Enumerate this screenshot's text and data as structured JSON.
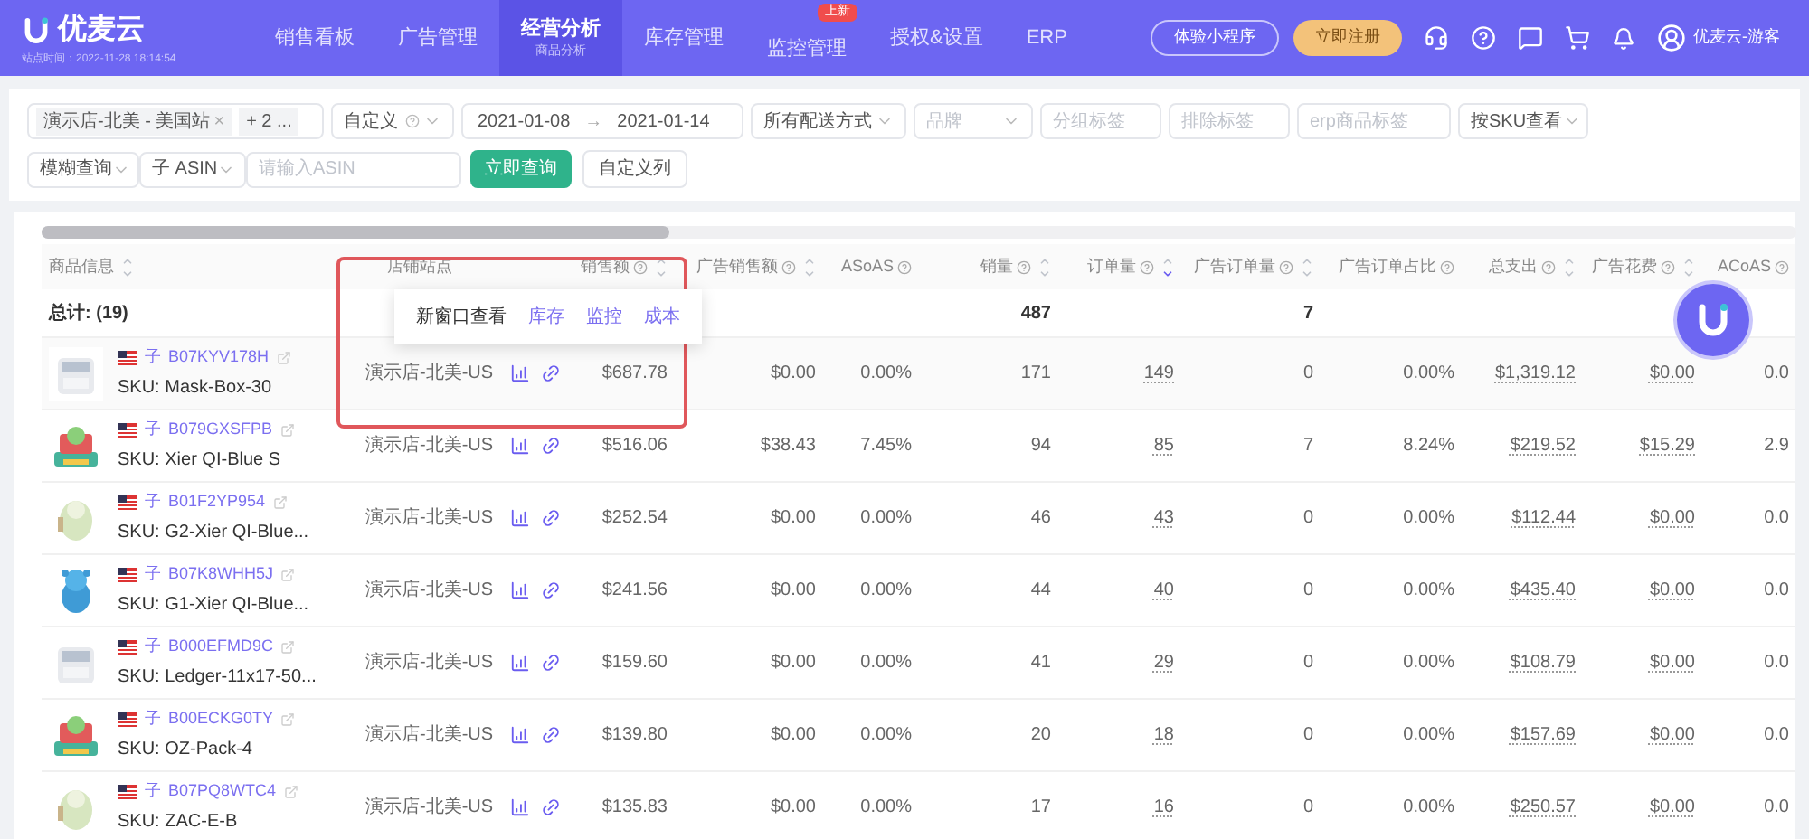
{
  "header": {
    "logo_text": "优麦云",
    "site_time": "站点时间：2022-11-28 18:14:54",
    "nav": [
      {
        "label": "销售看板",
        "selected": false
      },
      {
        "label": "广告管理",
        "selected": false
      },
      {
        "label": "经营分析",
        "sub": "商品分析",
        "selected": true
      },
      {
        "label": "库存管理",
        "selected": false
      },
      {
        "label": "监控管理",
        "badge": "上新",
        "selected": false
      },
      {
        "label": "授权&设置",
        "selected": false
      },
      {
        "label": "ERP",
        "selected": false
      }
    ],
    "trial_button": "体验小程序",
    "register_button": "立即注册",
    "user": "优麦云-游客"
  },
  "filters": {
    "store_tag": "演示店-北美 - 美国站",
    "tag_remove": "×",
    "more_tags": "+ 2 ...",
    "date_mode": "自定义",
    "date_start": "2021-01-08",
    "date_arrow": "→",
    "date_end": "2021-01-14",
    "shipping": "所有配送方式",
    "brand_placeholder": "品牌",
    "group_placeholder": "分组标签",
    "exclude_placeholder": "排除标签",
    "erp_placeholder": "erp商品标签",
    "view_by": "按SKU查看",
    "match_mode": "模糊查询",
    "asin_type": "子 ASIN",
    "asin_placeholder": "请输入ASIN",
    "query_button": "立即查询",
    "columns_button": "自定义列"
  },
  "table": {
    "columns": [
      {
        "label": "商品信息",
        "help": false,
        "sortable": true,
        "sorted": false
      },
      {
        "label": "店铺站点",
        "help": false,
        "sortable": false
      },
      {
        "label": "销售额",
        "help": true,
        "sortable": true,
        "sorted": false
      },
      {
        "label": "广告销售额",
        "help": true,
        "sortable": true,
        "sorted": false
      },
      {
        "label": "ASoAS",
        "help": true,
        "sortable": false
      },
      {
        "label": "销量",
        "help": true,
        "sortable": true,
        "sorted": false
      },
      {
        "label": "订单量",
        "help": true,
        "sortable": true,
        "sorted": true
      },
      {
        "label": "广告订单量",
        "help": true,
        "sortable": true,
        "sorted": false
      },
      {
        "label": "广告订单占比",
        "help": true,
        "sortable": false
      },
      {
        "label": "总支出",
        "help": true,
        "sortable": true,
        "sorted": false
      },
      {
        "label": "广告花费",
        "help": true,
        "sortable": true,
        "sorted": false
      },
      {
        "label": "ACoAS",
        "help": true,
        "sortable": false
      }
    ],
    "total": {
      "label": "总计: (19)",
      "units": "487",
      "ad_orders": "7"
    },
    "rows": [
      {
        "type": "子",
        "asin": "B07KYV178H",
        "sku": "SKU: Mask-Box-30",
        "store": "演示店-北美-US",
        "sales": "$687.78",
        "ad_sales": "$0.00",
        "asoas": "0.00%",
        "units": "171",
        "orders": "149",
        "ad_orders": "0",
        "ad_share": "0.00%",
        "spend": "$1,319.12",
        "ad_spend": "$0.00",
        "acoas": "0.0"
      },
      {
        "type": "子",
        "asin": "B079GXSFPB",
        "sku": "SKU: Xier QI-Blue S",
        "store": "演示店-北美-US",
        "sales": "$516.06",
        "ad_sales": "$38.43",
        "asoas": "7.45%",
        "units": "94",
        "orders": "85",
        "ad_orders": "7",
        "ad_share": "8.24%",
        "spend": "$219.52",
        "ad_spend": "$15.29",
        "acoas": "2.9"
      },
      {
        "type": "子",
        "asin": "B01F2YP954",
        "sku": "SKU: G2-Xier QI-Blue...",
        "store": "演示店-北美-US",
        "sales": "$252.54",
        "ad_sales": "$0.00",
        "asoas": "0.00%",
        "units": "46",
        "orders": "43",
        "ad_orders": "0",
        "ad_share": "0.00%",
        "spend": "$112.44",
        "ad_spend": "$0.00",
        "acoas": "0.0"
      },
      {
        "type": "子",
        "asin": "B07K8WHH5J",
        "sku": "SKU: G1-Xier QI-Blue...",
        "store": "演示店-北美-US",
        "sales": "$241.56",
        "ad_sales": "$0.00",
        "asoas": "0.00%",
        "units": "44",
        "orders": "40",
        "ad_orders": "0",
        "ad_share": "0.00%",
        "spend": "$435.40",
        "ad_spend": "$0.00",
        "acoas": "0.0"
      },
      {
        "type": "子",
        "asin": "B000EFMD9C",
        "sku": "SKU: Ledger-11x17-50...",
        "store": "演示店-北美-US",
        "sales": "$159.60",
        "ad_sales": "$0.00",
        "asoas": "0.00%",
        "units": "41",
        "orders": "29",
        "ad_orders": "0",
        "ad_share": "0.00%",
        "spend": "$108.79",
        "ad_spend": "$0.00",
        "acoas": "0.0"
      },
      {
        "type": "子",
        "asin": "B00ECKG0TY",
        "sku": "SKU: OZ-Pack-4",
        "store": "演示店-北美-US",
        "sales": "$139.80",
        "ad_sales": "$0.00",
        "asoas": "0.00%",
        "units": "20",
        "orders": "18",
        "ad_orders": "0",
        "ad_share": "0.00%",
        "spend": "$157.69",
        "ad_spend": "$0.00",
        "acoas": "0.0"
      },
      {
        "type": "子",
        "asin": "B07PQ8WTC4",
        "sku": "SKU: ZAC-E-B",
        "store": "演示店-北美-US",
        "sales": "$135.83",
        "ad_sales": "$0.00",
        "asoas": "0.00%",
        "units": "17",
        "orders": "16",
        "ad_orders": "0",
        "ad_share": "0.00%",
        "spend": "$250.57",
        "ad_spend": "$0.00",
        "acoas": "0.0"
      }
    ]
  },
  "popup": {
    "items": [
      "新窗口查看",
      "库存",
      "监控",
      "成本"
    ]
  }
}
